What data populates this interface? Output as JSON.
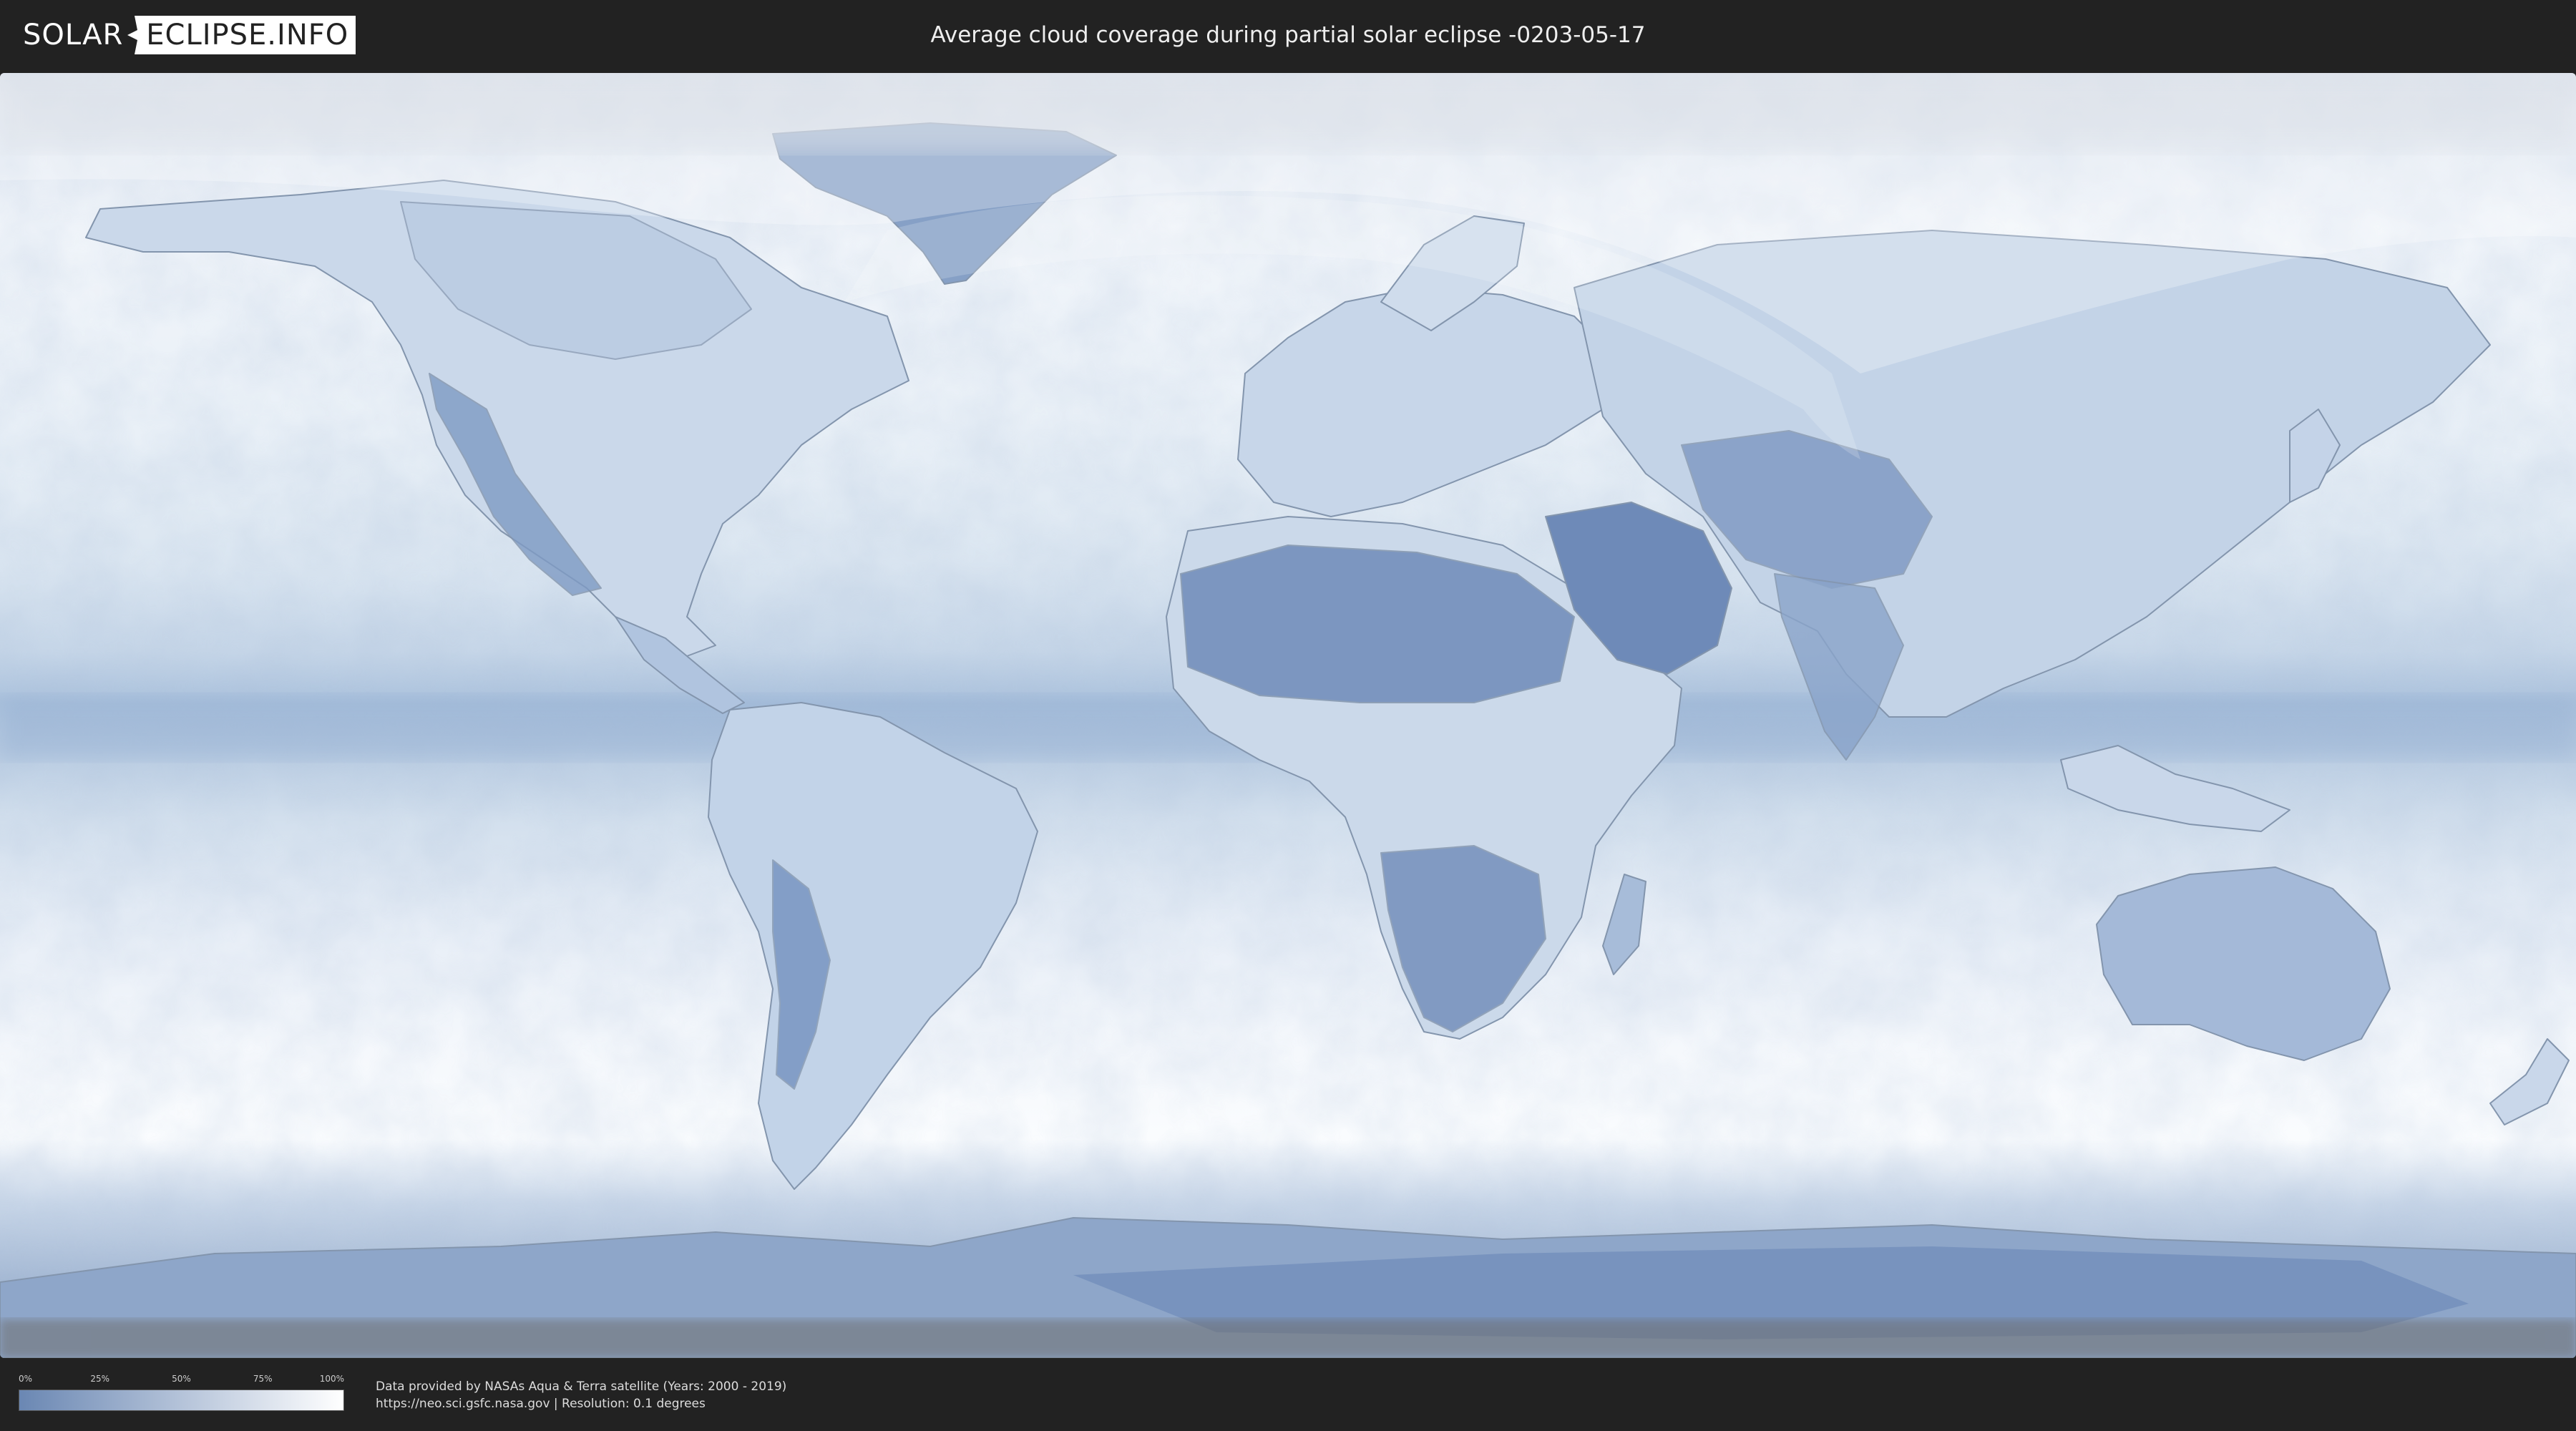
{
  "header": {
    "logo_left": "SOLAR",
    "logo_right": "ECLIPSE.INFO",
    "title": "Average cloud coverage during partial solar eclipse -0203-05-17"
  },
  "map": {
    "projection": "equirectangular",
    "layer": "average cloud coverage",
    "colors": {
      "clear": "#6a87b3",
      "cloudy": "#ffffff",
      "eclipse_overlay": "#ffffff",
      "borders": "#7e8fa5",
      "night_band": "#777777"
    }
  },
  "legend": {
    "ticks": [
      "0%",
      "25%",
      "50%",
      "75%",
      "100%"
    ],
    "tick_fractions": [
      0,
      0.25,
      0.5,
      0.75,
      1
    ],
    "gradient_from": "#6a87b3",
    "gradient_to": "#ffffff"
  },
  "footer": {
    "source_line1": "Data provided by NASAs Aqua & Terra satellite (Years: 2000 - 2019)",
    "source_line2": "https://neo.sci.gsfc.nasa.gov | Resolution: 0.1 degrees"
  }
}
